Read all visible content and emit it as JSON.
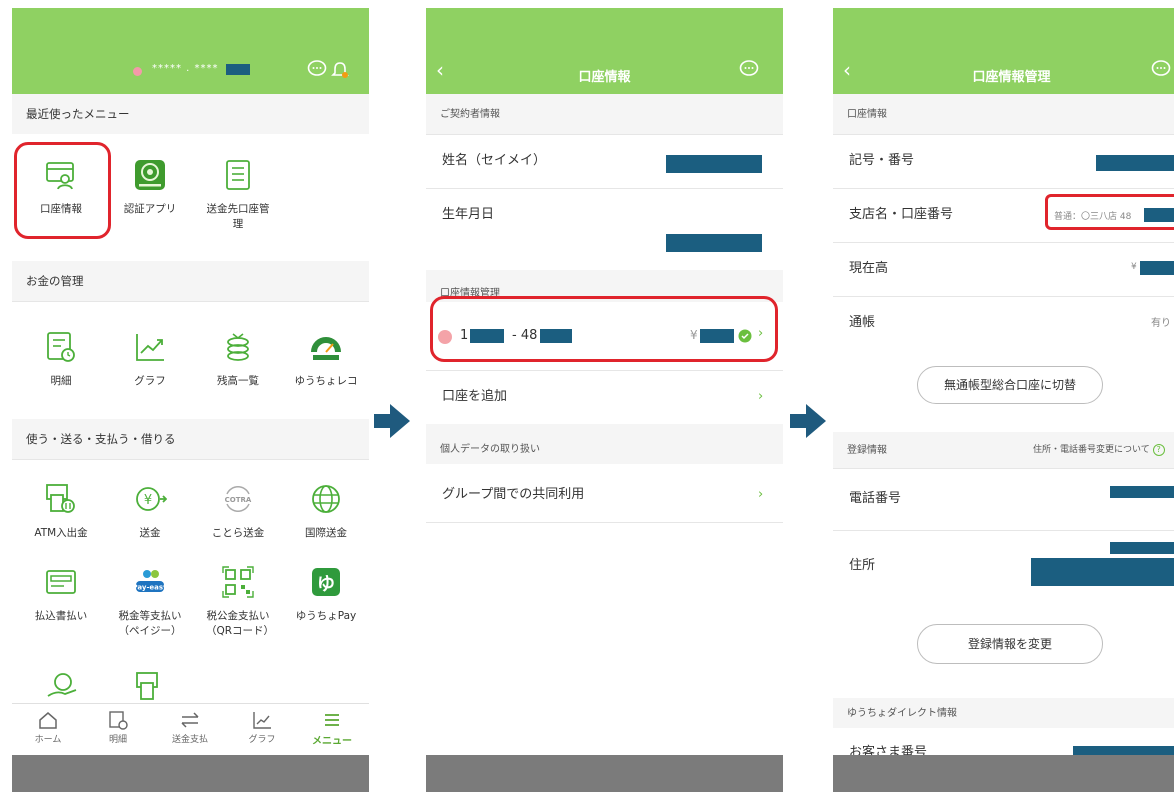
{
  "screen1": {
    "masked_user": "***** . ****",
    "recent_menu_title": "最近使ったメニュー",
    "recent": [
      {
        "label": "口座情報",
        "icon": "account-card-icon"
      },
      {
        "label": "認証アプリ",
        "icon": "auth-app-icon"
      },
      {
        "label": "送金先口座管理",
        "icon": "transfer-account-list-icon"
      }
    ],
    "money_title": "お金の管理",
    "money": [
      {
        "label": "明細",
        "icon": "statement-icon"
      },
      {
        "label": "グラフ",
        "icon": "graph-icon"
      },
      {
        "label": "残高一覧",
        "icon": "balance-list-icon"
      },
      {
        "label": "ゆうちょレコ",
        "icon": "yucho-reco-icon"
      }
    ],
    "pay_title": "使う・送る・支払う・借りる",
    "pay": [
      {
        "label": "ATM入出金",
        "icon": "atm-icon"
      },
      {
        "label": "送金",
        "icon": "send-money-icon"
      },
      {
        "label": "ことら送金",
        "icon": "cotra-icon",
        "logo_text": "COTRA"
      },
      {
        "label": "国際送金",
        "icon": "globe-icon"
      },
      {
        "label": "払込書払い",
        "icon": "payment-slip-icon"
      },
      {
        "label": "税金等支払い（ペイジー）",
        "icon": "payeasy-icon",
        "logo_text": "Pay-easy"
      },
      {
        "label": "税公金支払い（QRコード）",
        "icon": "qr-code-icon"
      },
      {
        "label": "ゆうちょPay",
        "icon": "yucho-pay-icon"
      }
    ],
    "tabs": [
      {
        "label": "ホーム",
        "icon": "home-icon"
      },
      {
        "label": "明細",
        "icon": "statement-icon"
      },
      {
        "label": "送金支払",
        "icon": "transfer-icon"
      },
      {
        "label": "グラフ",
        "icon": "graph-icon"
      },
      {
        "label": "メニュー",
        "icon": "menu-icon"
      }
    ]
  },
  "screen2": {
    "title": "口座情報",
    "contract_header": "ご契約者情報",
    "name_label": "姓名（セイメイ）",
    "birth_label": "生年月日",
    "account_mgmt_header": "口座情報管理",
    "account_num_prefix": "1",
    "account_num_mid": "- 48",
    "yen_mark": "¥",
    "add_account": "口座を追加",
    "personal_data_header": "個人データの取り扱い",
    "group_use": "グループ間での共同利用"
  },
  "screen3": {
    "title": "口座情報管理",
    "account_header": "口座情報",
    "symbol_number": "記号・番号",
    "branch_label": "支店名・口座番号",
    "branch_value": "普通：〇三八店 48",
    "balance_label": "現在高",
    "yen_mark": "¥",
    "passbook_label": "通帳",
    "passbook_value": "有り",
    "switch_button": "無通帳型総合口座に切替",
    "reg_header": "登録情報",
    "reg_help": "住所・電話番号変更について",
    "phone_label": "電話番号",
    "address_label": "住所",
    "change_button": "登録情報を変更",
    "direct_header": "ゆうちょダイレクト情報",
    "customer_no": "お客さま番号"
  },
  "colors": {
    "brand_green": "#8fd162",
    "accent_green": "#6bbf3f",
    "highlight_red": "#e0242c",
    "redaction": "#1b5e80",
    "arrow_blue": "#1f5a7e"
  }
}
